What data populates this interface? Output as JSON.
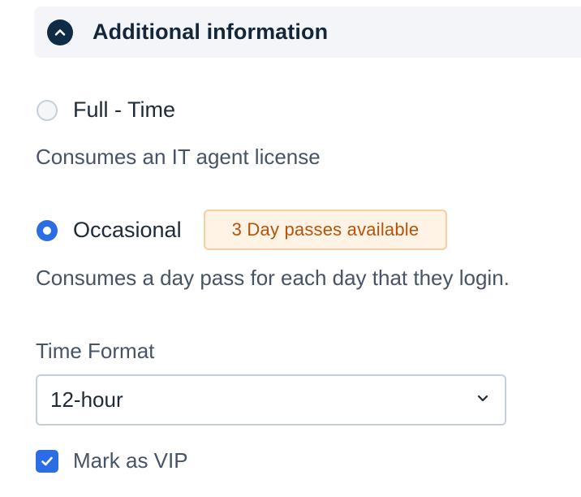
{
  "section": {
    "title": "Additional information",
    "toggle_icon": "chevron-up-icon"
  },
  "license_options": [
    {
      "label": "Full - Time",
      "description": "Consumes an IT agent license",
      "selected": false
    },
    {
      "label": "Occasional",
      "badge": "3 Day passes available",
      "description": "Consumes a day pass for each day that they login.",
      "selected": true
    }
  ],
  "time_format": {
    "label": "Time Format",
    "value": "12-hour",
    "icon": "chevron-down-icon"
  },
  "vip": {
    "label": "Mark as VIP",
    "checked": true
  },
  "colors": {
    "accent": "#2c6ce4",
    "badge_text": "#b45309",
    "badge_bg": "#fef3e4",
    "header_icon_bg": "#0f2b46"
  }
}
